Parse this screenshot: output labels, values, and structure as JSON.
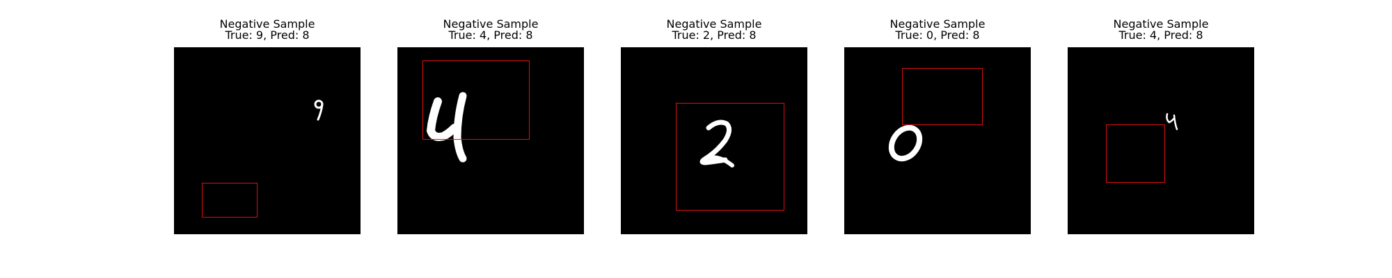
{
  "colors": {
    "background": "#ffffff",
    "image_background": "#000000",
    "digit": "#ffffff",
    "box": "#e01010"
  },
  "samples": [
    {
      "title": "Negative Sample",
      "caption": "True: 9, Pred: 8",
      "true_label": 9,
      "pred_label": 8
    },
    {
      "title": "Negative Sample",
      "caption": "True: 4, Pred: 8",
      "true_label": 4,
      "pred_label": 8
    },
    {
      "title": "Negative Sample",
      "caption": "True: 2, Pred: 8",
      "true_label": 2,
      "pred_label": 8
    },
    {
      "title": "Negative Sample",
      "caption": "True: 0, Pred: 8",
      "true_label": 0,
      "pred_label": 8
    },
    {
      "title": "Negative Sample",
      "caption": "True: 4, Pred: 8",
      "true_label": 4,
      "pred_label": 8
    }
  ]
}
